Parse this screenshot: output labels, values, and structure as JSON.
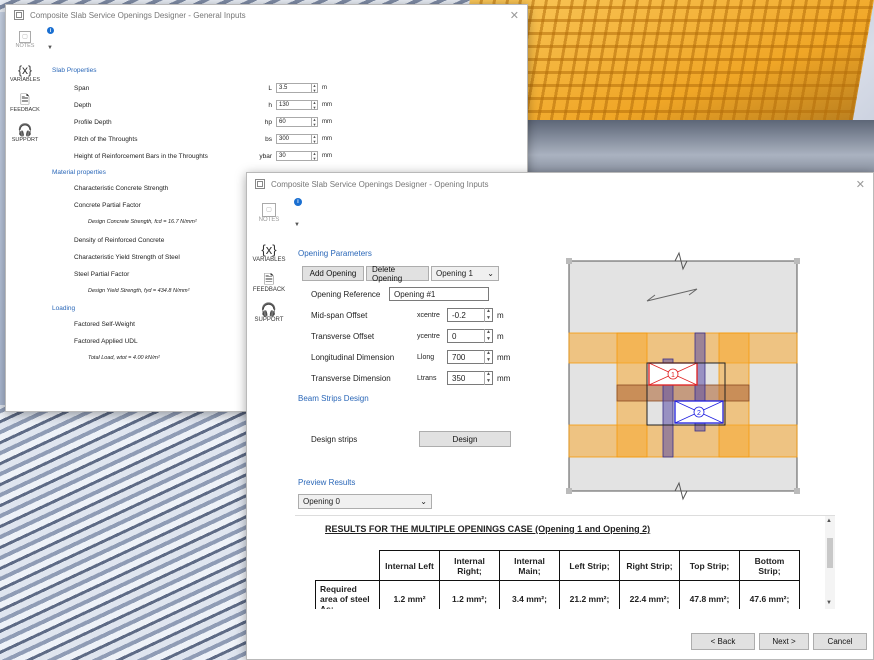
{
  "window1": {
    "title": "Composite Slab Service Openings Designer - General Inputs",
    "sidebar": {
      "notes": "NOTES",
      "variables": "VARIABLES",
      "feedback": "FEEDBACK",
      "support": "SUPPORT"
    },
    "sections": {
      "slab": "Slab Properties",
      "material": "Material properties",
      "loading": "Loading"
    },
    "slab_rows": [
      {
        "label": "Span",
        "sym": "L",
        "value": "3.5",
        "unit": "m"
      },
      {
        "label": "Depth",
        "sym": "h",
        "value": "130",
        "unit": "mm"
      },
      {
        "label": "Profile Depth",
        "sym": "hp",
        "value": "60",
        "unit": "mm"
      },
      {
        "label": "Pitch of the Throughts",
        "sym": "bs",
        "value": "300",
        "unit": "mm"
      },
      {
        "label": "Height of Reinforcement Bars in the Throughts",
        "sym": "ybar",
        "value": "30",
        "unit": "mm"
      }
    ],
    "material_rows": [
      "Characteristic Concrete Strength",
      "Concrete Partial Factor",
      "Design Concrete Strength, fcd = 16.7 N/mm²",
      "Density of Reinforced Concrete",
      "Characteristic Yield Strength of Steel",
      "Steel Partial Factor",
      "Design Yield Strength, fyd = 434.8 N/mm²"
    ],
    "loading_rows": [
      "Factored Self-Weight",
      "Factored Applied UDL",
      "Total Load, wtot = 4.00 kN/m²"
    ]
  },
  "window2": {
    "title": "Composite Slab Service Openings Designer - Opening Inputs",
    "sidebar": {
      "notes": "NOTES",
      "variables": "VARIABLES",
      "feedback": "FEEDBACK",
      "support": "SUPPORT"
    },
    "opening_params": {
      "heading": "Opening Parameters",
      "add_label": "Add Opening",
      "delete_label": "Delete Opening",
      "select_value": "Opening 1",
      "reference_label": "Opening Reference",
      "reference_value": "Opening #1",
      "fields": [
        {
          "label": "Mid-span Offset",
          "sym": "xcentre",
          "value": "-0.2",
          "unit": "m"
        },
        {
          "label": "Transverse Offset",
          "sym": "ycentre",
          "value": "0",
          "unit": "m"
        },
        {
          "label": "Longitudinal Dimension",
          "sym": "Llong",
          "value": "700",
          "unit": "mm"
        },
        {
          "label": "Transverse Dimension",
          "sym": "Ltrans",
          "value": "350",
          "unit": "mm"
        }
      ]
    },
    "beam_strips": {
      "heading": "Beam Strips Design",
      "design_label": "Design strips",
      "design_button": "Design"
    },
    "preview": {
      "heading": "Preview Results",
      "select_value": "Opening 0"
    },
    "diagram_labels": {
      "opening1": "1",
      "opening2": "2"
    },
    "results": {
      "title": "RESULTS FOR THE MULTIPLE OPENINGS CASE (Opening 1 and Opening 2)",
      "headers": [
        "Internal Left",
        "Internal Right;",
        "Internal Main;",
        "Left Strip;",
        "Right Strip;",
        "Top Strip;",
        "Bottom Strip;"
      ],
      "row_label": "Required area of steel As;",
      "values": [
        "1.2 mm²",
        "1.2 mm²;",
        "3.4 mm²;",
        "21.2 mm²;",
        "22.4 mm²;",
        "47.8 mm²;",
        "47.6 mm²;"
      ]
    },
    "footer": {
      "back": "< Back",
      "next": "Next >",
      "cancel": "Cancel"
    }
  },
  "colors": {
    "accent": "#2a67b8",
    "strip_orange": "#f7a933",
    "opening_red": "#e02020",
    "opening_blue": "#2020e0",
    "strip_purple": "#5b4ea8"
  }
}
